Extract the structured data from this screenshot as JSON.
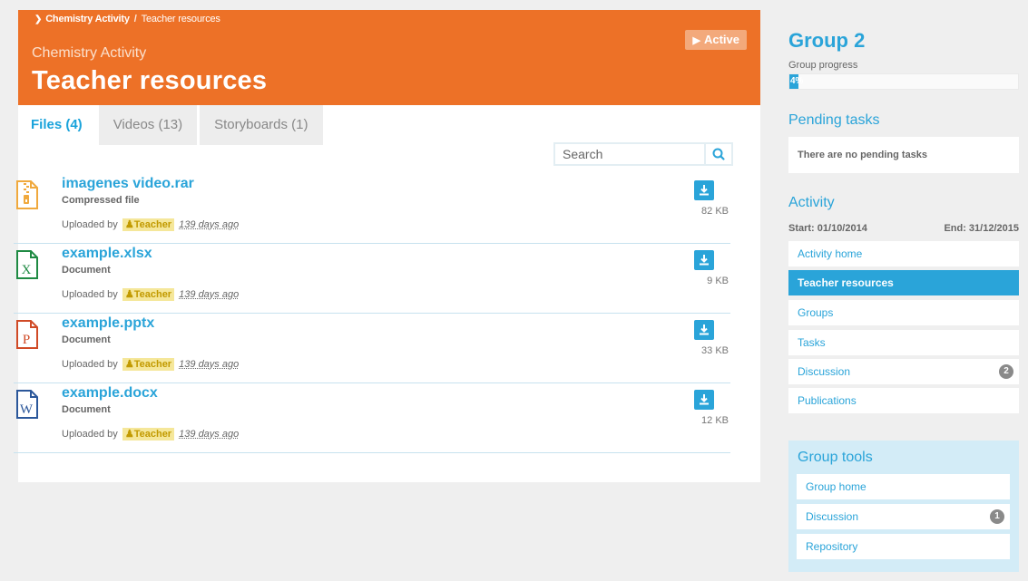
{
  "breadcrumb": {
    "root": "Chemistry Activity",
    "current": "Teacher resources"
  },
  "header": {
    "subtitle": "Chemistry Activity",
    "title": "Teacher resources",
    "status": "Active"
  },
  "tabs": [
    {
      "label": "Files (4)",
      "active": true
    },
    {
      "label": "Videos (13)",
      "active": false
    },
    {
      "label": "Storyboards (1)",
      "active": false
    }
  ],
  "search": {
    "placeholder": "Search"
  },
  "files": [
    {
      "name": "imagenes video.rar",
      "type": "Compressed file",
      "uploaded_prefix": "Uploaded by",
      "uploader": "Teacher",
      "when": "139 days ago",
      "size": "82 KB",
      "icon": "zip-file-icon"
    },
    {
      "name": "example.xlsx",
      "type": "Document",
      "uploaded_prefix": "Uploaded by",
      "uploader": "Teacher",
      "when": "139 days ago",
      "size": "9 KB",
      "icon": "excel-file-icon"
    },
    {
      "name": "example.pptx",
      "type": "Document",
      "uploaded_prefix": "Uploaded by",
      "uploader": "Teacher",
      "when": "139 days ago",
      "size": "33 KB",
      "icon": "powerpoint-file-icon"
    },
    {
      "name": "example.docx",
      "type": "Document",
      "uploaded_prefix": "Uploaded by",
      "uploader": "Teacher",
      "when": "139 days ago",
      "size": "12 KB",
      "icon": "word-file-icon"
    }
  ],
  "group": {
    "title": "Group 2",
    "progress_label": "Group progress",
    "progress_text": "4%",
    "progress_value": 0.04
  },
  "pending": {
    "title": "Pending tasks",
    "empty_text": "There are no pending tasks"
  },
  "activity": {
    "title": "Activity",
    "start": "Start: 01/10/2014",
    "end": "End: 31/12/2015",
    "nav": [
      {
        "label": "Activity home",
        "active": false,
        "badge": ""
      },
      {
        "label": "Teacher resources",
        "active": true,
        "badge": ""
      },
      {
        "label": "Groups",
        "active": false,
        "badge": ""
      },
      {
        "label": "Tasks",
        "active": false,
        "badge": ""
      },
      {
        "label": "Discussion",
        "active": false,
        "badge": "2"
      },
      {
        "label": "Publications",
        "active": false,
        "badge": ""
      }
    ]
  },
  "tools": {
    "title": "Group tools",
    "items": [
      {
        "label": "Group home",
        "badge": ""
      },
      {
        "label": "Discussion",
        "badge": "1"
      },
      {
        "label": "Repository",
        "badge": ""
      }
    ]
  },
  "colors": {
    "accent": "#2aa4d9",
    "header": "#ed7127",
    "uploader_badge": "#f5e79a"
  }
}
